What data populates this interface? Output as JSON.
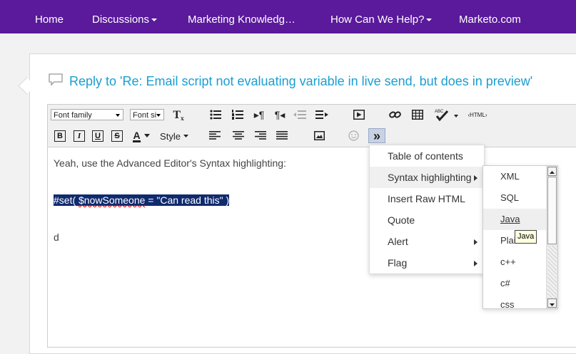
{
  "nav": {
    "items": [
      {
        "label": "Home",
        "caret": false
      },
      {
        "label": "Discussions",
        "caret": true
      },
      {
        "label": "Marketing Knowledg…",
        "caret": false
      },
      {
        "label": "How Can We Help?",
        "caret": true
      },
      {
        "label": "Marketo.com",
        "caret": false
      }
    ]
  },
  "reply": {
    "title": "Reply to 'Re: Email script not evaluating variable in live send, but does in preview'"
  },
  "toolbar": {
    "font_family": "Font family",
    "font_size": "Font si",
    "style_label": "Style",
    "html_label": "‹HTML›",
    "bold": "B",
    "italic": "I",
    "underline": "U",
    "strike": "S",
    "font_color": "A",
    "clear_format": "T",
    "clear_format_sub": "x",
    "more": "»"
  },
  "editor": {
    "line1": "Yeah, use the Advanced Editor's Syntax highlighting:",
    "line2_pre": "#set( ",
    "line2_misspelled": "$nowSomeone",
    "line2_post": " = \"Can read this\" )",
    "line3": "d"
  },
  "menu": {
    "items": [
      {
        "label": "Table of contents",
        "submenu": false
      },
      {
        "label": "Syntax highlighting",
        "submenu": true
      },
      {
        "label": "Insert Raw HTML",
        "submenu": false
      },
      {
        "label": "Quote",
        "submenu": false
      },
      {
        "label": "Alert",
        "submenu": true
      },
      {
        "label": "Flag",
        "submenu": true
      }
    ]
  },
  "submenu": {
    "items": [
      "XML",
      "SQL",
      "Java",
      "Plain",
      "c++",
      "c#",
      "css"
    ],
    "hovered": "Java"
  },
  "tooltip": "Java",
  "colors": {
    "nav_bg": "#5a1a9b",
    "title": "#1a9ed1",
    "selection": "#102a6e"
  }
}
